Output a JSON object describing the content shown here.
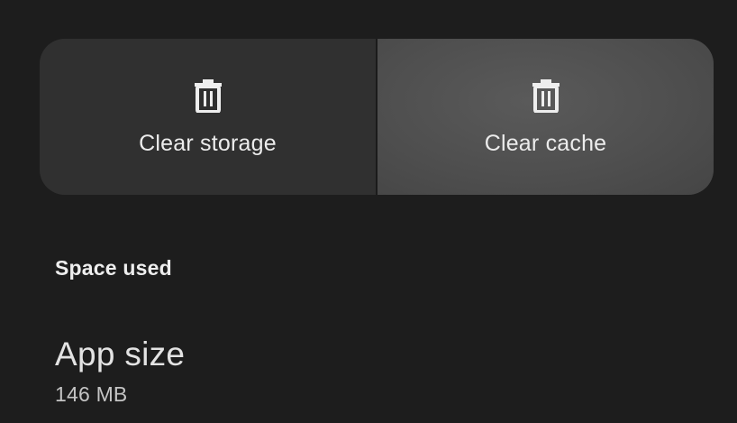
{
  "actions": {
    "clear_storage": {
      "label": "Clear storage",
      "icon": "trash-icon"
    },
    "clear_cache": {
      "label": "Clear cache",
      "icon": "trash-icon"
    }
  },
  "space_used": {
    "section_title": "Space used",
    "app_size": {
      "title": "App size",
      "value": "146 MB"
    }
  },
  "colors": {
    "background": "#1d1d1d",
    "button_storage": "#303030",
    "button_cache_pressed": "#525252",
    "text_primary": "#ececec",
    "text_secondary": "#c4c4c4"
  }
}
